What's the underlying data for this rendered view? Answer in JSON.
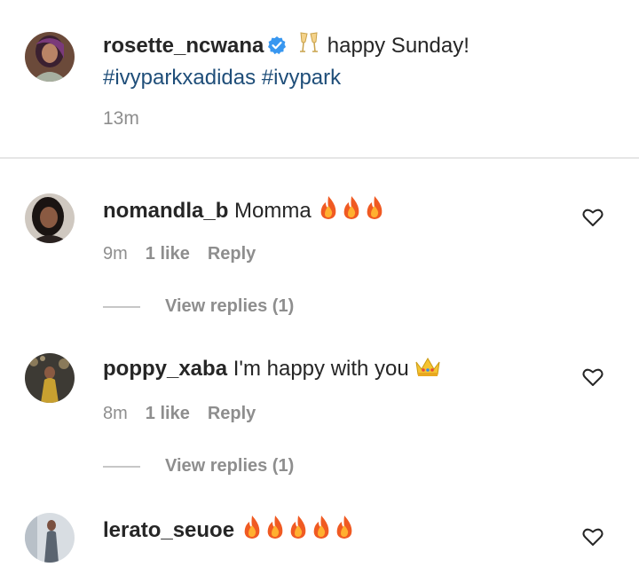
{
  "post": {
    "username": "rosette_ncwana",
    "caption_emoji": "champagne-glasses-emoji",
    "caption_text": "happy Sunday!",
    "hashtags": "#ivyparkxadidas #ivypark",
    "time": "13m"
  },
  "comments": [
    {
      "username": "nomandla_b",
      "text": "Momma",
      "emoji": "fire-emoji x3",
      "time": "9m",
      "likes": "1 like",
      "reply_label": "Reply",
      "view_replies": "View replies (1)"
    },
    {
      "username": "poppy_xaba",
      "text": "I'm happy with you",
      "emoji": "crown-emoji",
      "time": "8m",
      "likes": "1 like",
      "reply_label": "Reply",
      "view_replies": "View replies (1)"
    },
    {
      "username": "lerato_seuoe",
      "text": "",
      "emoji": "fire-emoji x5"
    }
  ],
  "colors": {
    "hashtag": "#1f4e79",
    "verified": "#3897f0",
    "meta_gray": "#8e8e8e",
    "divider": "#e6e6e6"
  }
}
